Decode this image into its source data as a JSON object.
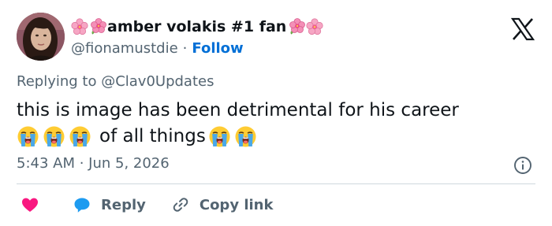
{
  "author": {
    "display_name": "amber volakis #1 fan",
    "handle": "@fionamustdie",
    "separator": "·",
    "follow_label": "Follow"
  },
  "tweet": {
    "replying_to": "Replying to @Clav0Updates",
    "line1": "this is image has been detrimental for his career",
    "line2_text": "of all things",
    "timestamp": "5:43 AM · Jun 5, 2026"
  },
  "actions": {
    "reply_label": "Reply",
    "copy_link_label": "Copy link"
  },
  "icons": {
    "brand": "x-logo-icon",
    "info": "info-icon",
    "like": "heart-icon",
    "reply": "speech-bubble-icon",
    "link": "link-icon",
    "name_decoration": "cherry-blossom-emoji",
    "reaction": "loudly-crying-face-emoji"
  },
  "colors": {
    "text": "#0f1419",
    "secondary": "#536471",
    "follow": "#006fd6",
    "like": "#f91880",
    "reply": "#1d9bf0",
    "divider": "#cfd9de"
  }
}
